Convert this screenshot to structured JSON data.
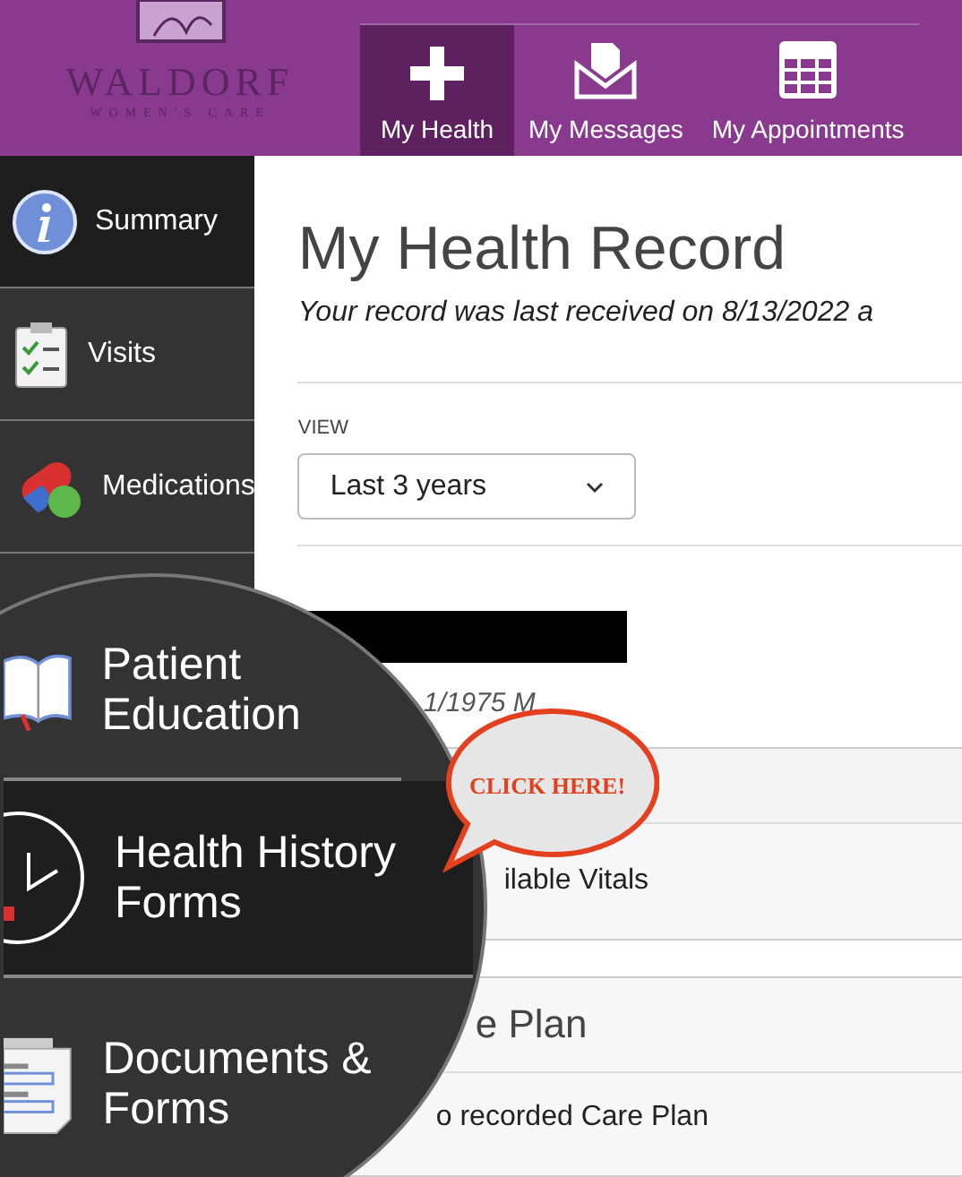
{
  "logo": {
    "name": "WALDORF",
    "tagline": "WOMEN'S CARE"
  },
  "nav_tabs": [
    {
      "label": "My Health",
      "selected": true
    },
    {
      "label": "My Messages",
      "selected": false
    },
    {
      "label": "My Appointments",
      "selected": false
    }
  ],
  "sidebar": {
    "items": [
      {
        "label": "Summary",
        "selected": true
      },
      {
        "label": "Visits",
        "selected": false
      },
      {
        "label": "Medications",
        "selected": false
      }
    ]
  },
  "magnifier": {
    "items": [
      {
        "label": "Patient Education",
        "selected": false
      },
      {
        "label": "Health History Forms",
        "selected": true
      },
      {
        "label": "Documents & Forms",
        "selected": false
      }
    ]
  },
  "callout": {
    "text": "CLICK HERE!"
  },
  "main": {
    "title": "My Health Record",
    "subtitle": "Your record was last received on 8/13/2022 a",
    "view": {
      "label": "VIEW",
      "value": "Last 3 years"
    },
    "patient_details": "1/1975 M",
    "vitals_row": "ilable Vitals",
    "care_plan": {
      "heading": "e Plan",
      "row": "o recorded Care Plan"
    }
  }
}
